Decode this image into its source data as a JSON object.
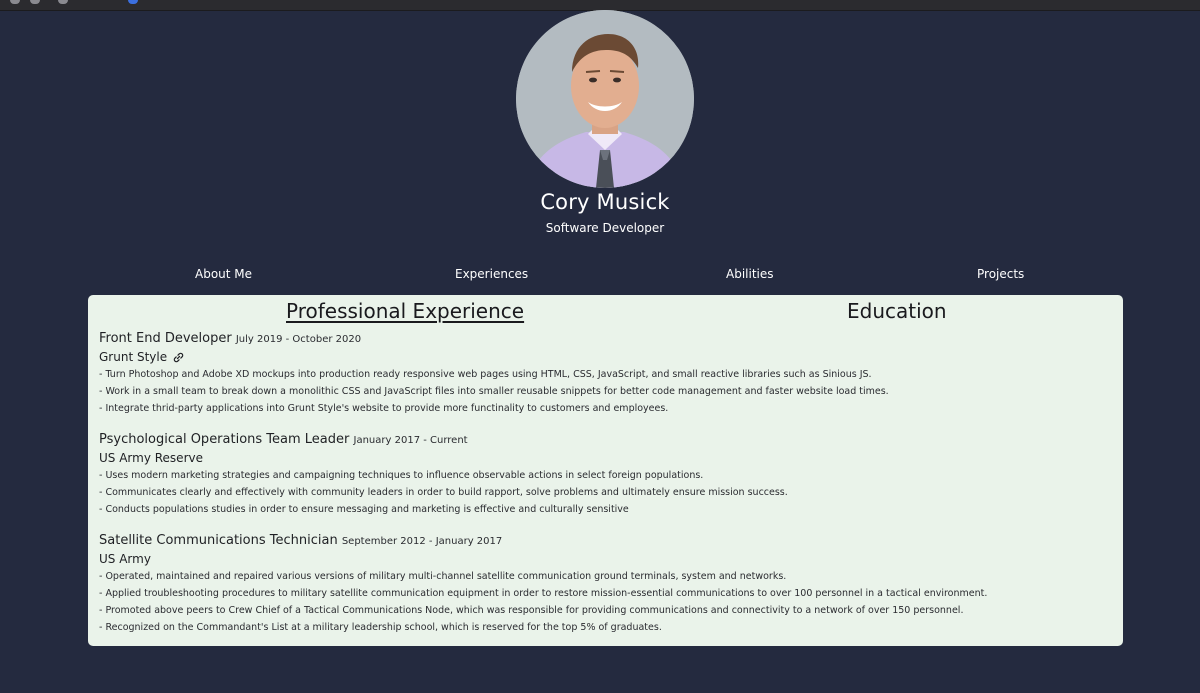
{
  "profile": {
    "name": "Cory Musick",
    "role": "Software Developer"
  },
  "nav": {
    "about": "About Me",
    "experiences": "Experiences",
    "abilities": "Abilities",
    "projects": "Projects"
  },
  "sections": {
    "experience_title": "Professional Experience",
    "education_title": "Education"
  },
  "jobs": [
    {
      "title": "Front End Developer",
      "dates": "July 2019 - October 2020",
      "company": "Grunt Style",
      "company_icon": "link-icon",
      "bullets": [
        "- Turn Photoshop and Adobe XD mockups into production ready responsive web pages using HTML, CSS, JavaScript, and small reactive libraries such as Sinious JS.",
        "- Work in a small team to break down a monolithic CSS and JavaScript files into smaller reusable snippets for better code management and faster website load times.",
        "- Integrate thrid-party applications into Grunt Style's website to provide more functinality to customers and employees."
      ]
    },
    {
      "title": "Psychological Operations Team Leader",
      "dates": "January 2017 - Current",
      "company": "US Army Reserve",
      "bullets": [
        "- Uses modern marketing strategies and campaigning techniques to influence observable actions in select foreign populations.",
        "- Communicates clearly and effectively with community leaders in order to build rapport, solve problems and ultimately ensure mission success.",
        "- Conducts populations studies in order to ensure messaging and marketing is effective and culturally sensitive"
      ]
    },
    {
      "title": "Satellite Communications Technician",
      "dates": "September 2012 - January 2017",
      "company": "US Army",
      "bullets": [
        "- Operated, maintained and repaired various versions of military multi-channel satellite communication ground terminals, system and networks.",
        "- Applied troubleshooting procedures to military satellite communication equipment in order to restore mission-essential communications to over 100 personnel in a tactical environment.",
        "- Promoted above peers to Crew Chief of a Tactical Communications Node, which was responsible for providing communications and connectivity to a network of over 150 personnel.",
        "- Recognized on the Commandant's List at a military leadership school, which is reserved for the top 5% of graduates."
      ]
    }
  ],
  "colors": {
    "background": "#242a3f",
    "card": "#eaf3ea",
    "text_light": "#ffffff",
    "text_dark": "#1f2024"
  }
}
